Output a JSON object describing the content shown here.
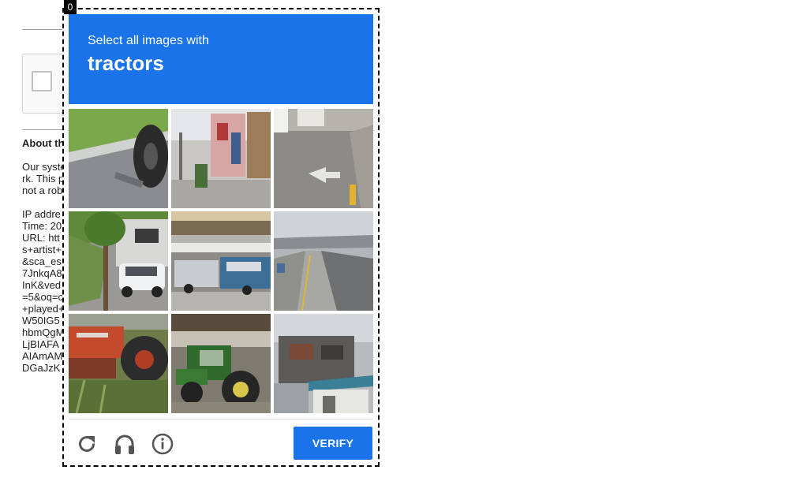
{
  "background": {
    "heading": "About th",
    "paragraph_lines": [
      "Our syste",
      "rk. This p",
      "not a rob"
    ],
    "info_lines": [
      "IP addre",
      "Time: 20",
      "URL: htt",
      "s+artist+",
      "&sca_es",
      "7JnkqA8",
      "InK&ved",
      "=5&oq=c",
      "+played+",
      "W50IG5",
      "hbmQgM",
      "LjBIAFA",
      "AIAmAM",
      "DGaJzK"
    ]
  },
  "frame": {
    "label": "0"
  },
  "challenge": {
    "instruction": "Select all images with",
    "object": "tractors",
    "tiles": [
      {
        "id": 1,
        "content": "road with tractor wheel"
      },
      {
        "id": 2,
        "content": "shop front street"
      },
      {
        "id": 3,
        "content": "road with arrow marking"
      },
      {
        "id": 4,
        "content": "white car and tree"
      },
      {
        "id": 5,
        "content": "jeepney bus"
      },
      {
        "id": 6,
        "content": "overpass road"
      },
      {
        "id": 7,
        "content": "red tractor"
      },
      {
        "id": 8,
        "content": "green tractor"
      },
      {
        "id": 9,
        "content": "building facade"
      }
    ]
  },
  "footer": {
    "icons": [
      "reload-icon",
      "audio-icon",
      "info-icon"
    ],
    "verify_label": "VERIFY"
  },
  "colors": {
    "accent": "#1a73e8",
    "header_text": "#ffffff"
  }
}
